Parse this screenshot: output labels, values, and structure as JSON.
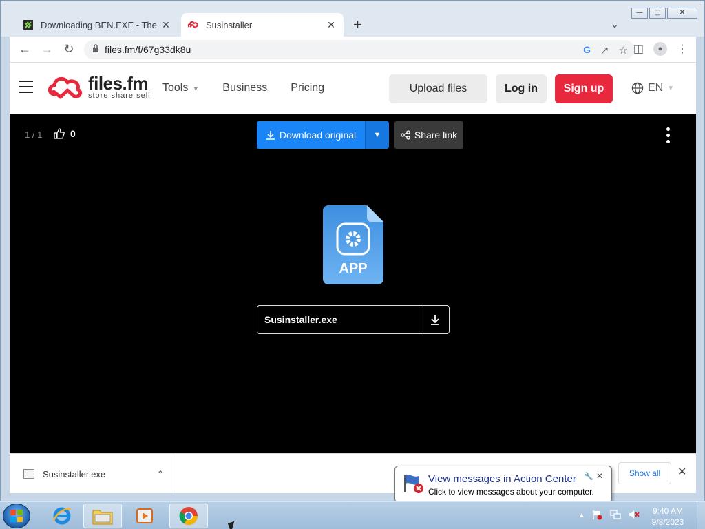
{
  "browser": {
    "tabs": [
      {
        "title": "Downloading BEN.EXE - The Coll",
        "active": false
      },
      {
        "title": "Susinstaller",
        "active": true
      }
    ],
    "new_tab_label": "+",
    "url": "files.fm/f/67g33dk8u"
  },
  "site": {
    "logo_name": "files.fm",
    "logo_tagline": "store  share  sell",
    "nav": [
      "Tools",
      "Business",
      "Pricing"
    ],
    "upload_label": "Upload files",
    "login_label": "Log in",
    "signup_label": "Sign up",
    "lang_label": "EN",
    "brand_color": "#e8283c"
  },
  "viewer": {
    "counter": "1 / 1",
    "likes": "0",
    "download_label": "Download original",
    "share_label": "Share link",
    "file_type_label": "APP",
    "file_name": "Susinstaller.exe",
    "accent_color": "#1a85f7"
  },
  "download_shelf": {
    "item_name": "Susinstaller.exe",
    "show_all_label": "Show all"
  },
  "notification": {
    "title": "View messages in Action Center",
    "text": "Click to view messages about your computer."
  },
  "taskbar": {
    "time": "9:40 AM",
    "date": "9/8/2023"
  }
}
